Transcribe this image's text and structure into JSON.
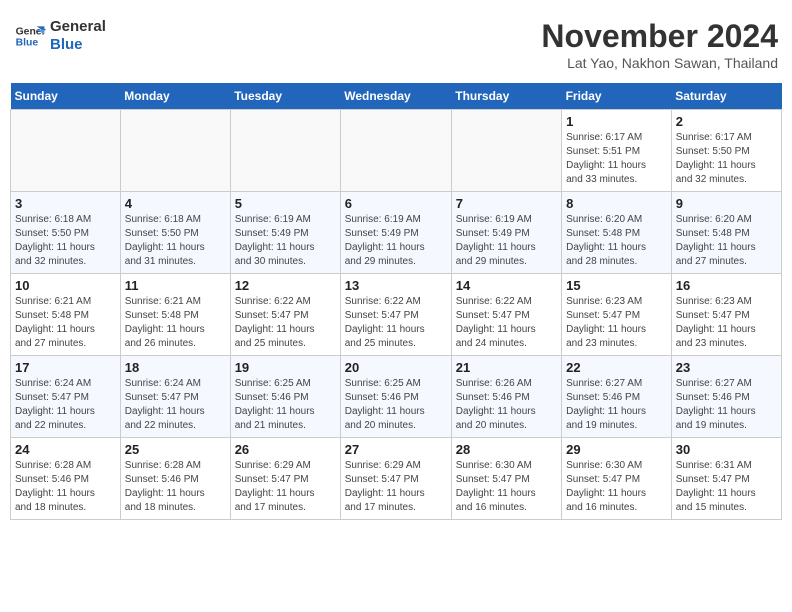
{
  "logo": {
    "line1": "General",
    "line2": "Blue"
  },
  "title": "November 2024",
  "subtitle": "Lat Yao, Nakhon Sawan, Thailand",
  "weekdays": [
    "Sunday",
    "Monday",
    "Tuesday",
    "Wednesday",
    "Thursday",
    "Friday",
    "Saturday"
  ],
  "weeks": [
    [
      {
        "day": "",
        "detail": ""
      },
      {
        "day": "",
        "detail": ""
      },
      {
        "day": "",
        "detail": ""
      },
      {
        "day": "",
        "detail": ""
      },
      {
        "day": "",
        "detail": ""
      },
      {
        "day": "1",
        "detail": "Sunrise: 6:17 AM\nSunset: 5:51 PM\nDaylight: 11 hours\nand 33 minutes."
      },
      {
        "day": "2",
        "detail": "Sunrise: 6:17 AM\nSunset: 5:50 PM\nDaylight: 11 hours\nand 32 minutes."
      }
    ],
    [
      {
        "day": "3",
        "detail": "Sunrise: 6:18 AM\nSunset: 5:50 PM\nDaylight: 11 hours\nand 32 minutes."
      },
      {
        "day": "4",
        "detail": "Sunrise: 6:18 AM\nSunset: 5:50 PM\nDaylight: 11 hours\nand 31 minutes."
      },
      {
        "day": "5",
        "detail": "Sunrise: 6:19 AM\nSunset: 5:49 PM\nDaylight: 11 hours\nand 30 minutes."
      },
      {
        "day": "6",
        "detail": "Sunrise: 6:19 AM\nSunset: 5:49 PM\nDaylight: 11 hours\nand 29 minutes."
      },
      {
        "day": "7",
        "detail": "Sunrise: 6:19 AM\nSunset: 5:49 PM\nDaylight: 11 hours\nand 29 minutes."
      },
      {
        "day": "8",
        "detail": "Sunrise: 6:20 AM\nSunset: 5:48 PM\nDaylight: 11 hours\nand 28 minutes."
      },
      {
        "day": "9",
        "detail": "Sunrise: 6:20 AM\nSunset: 5:48 PM\nDaylight: 11 hours\nand 27 minutes."
      }
    ],
    [
      {
        "day": "10",
        "detail": "Sunrise: 6:21 AM\nSunset: 5:48 PM\nDaylight: 11 hours\nand 27 minutes."
      },
      {
        "day": "11",
        "detail": "Sunrise: 6:21 AM\nSunset: 5:48 PM\nDaylight: 11 hours\nand 26 minutes."
      },
      {
        "day": "12",
        "detail": "Sunrise: 6:22 AM\nSunset: 5:47 PM\nDaylight: 11 hours\nand 25 minutes."
      },
      {
        "day": "13",
        "detail": "Sunrise: 6:22 AM\nSunset: 5:47 PM\nDaylight: 11 hours\nand 25 minutes."
      },
      {
        "day": "14",
        "detail": "Sunrise: 6:22 AM\nSunset: 5:47 PM\nDaylight: 11 hours\nand 24 minutes."
      },
      {
        "day": "15",
        "detail": "Sunrise: 6:23 AM\nSunset: 5:47 PM\nDaylight: 11 hours\nand 23 minutes."
      },
      {
        "day": "16",
        "detail": "Sunrise: 6:23 AM\nSunset: 5:47 PM\nDaylight: 11 hours\nand 23 minutes."
      }
    ],
    [
      {
        "day": "17",
        "detail": "Sunrise: 6:24 AM\nSunset: 5:47 PM\nDaylight: 11 hours\nand 22 minutes."
      },
      {
        "day": "18",
        "detail": "Sunrise: 6:24 AM\nSunset: 5:47 PM\nDaylight: 11 hours\nand 22 minutes."
      },
      {
        "day": "19",
        "detail": "Sunrise: 6:25 AM\nSunset: 5:46 PM\nDaylight: 11 hours\nand 21 minutes."
      },
      {
        "day": "20",
        "detail": "Sunrise: 6:25 AM\nSunset: 5:46 PM\nDaylight: 11 hours\nand 20 minutes."
      },
      {
        "day": "21",
        "detail": "Sunrise: 6:26 AM\nSunset: 5:46 PM\nDaylight: 11 hours\nand 20 minutes."
      },
      {
        "day": "22",
        "detail": "Sunrise: 6:27 AM\nSunset: 5:46 PM\nDaylight: 11 hours\nand 19 minutes."
      },
      {
        "day": "23",
        "detail": "Sunrise: 6:27 AM\nSunset: 5:46 PM\nDaylight: 11 hours\nand 19 minutes."
      }
    ],
    [
      {
        "day": "24",
        "detail": "Sunrise: 6:28 AM\nSunset: 5:46 PM\nDaylight: 11 hours\nand 18 minutes."
      },
      {
        "day": "25",
        "detail": "Sunrise: 6:28 AM\nSunset: 5:46 PM\nDaylight: 11 hours\nand 18 minutes."
      },
      {
        "day": "26",
        "detail": "Sunrise: 6:29 AM\nSunset: 5:47 PM\nDaylight: 11 hours\nand 17 minutes."
      },
      {
        "day": "27",
        "detail": "Sunrise: 6:29 AM\nSunset: 5:47 PM\nDaylight: 11 hours\nand 17 minutes."
      },
      {
        "day": "28",
        "detail": "Sunrise: 6:30 AM\nSunset: 5:47 PM\nDaylight: 11 hours\nand 16 minutes."
      },
      {
        "day": "29",
        "detail": "Sunrise: 6:30 AM\nSunset: 5:47 PM\nDaylight: 11 hours\nand 16 minutes."
      },
      {
        "day": "30",
        "detail": "Sunrise: 6:31 AM\nSunset: 5:47 PM\nDaylight: 11 hours\nand 15 minutes."
      }
    ]
  ]
}
